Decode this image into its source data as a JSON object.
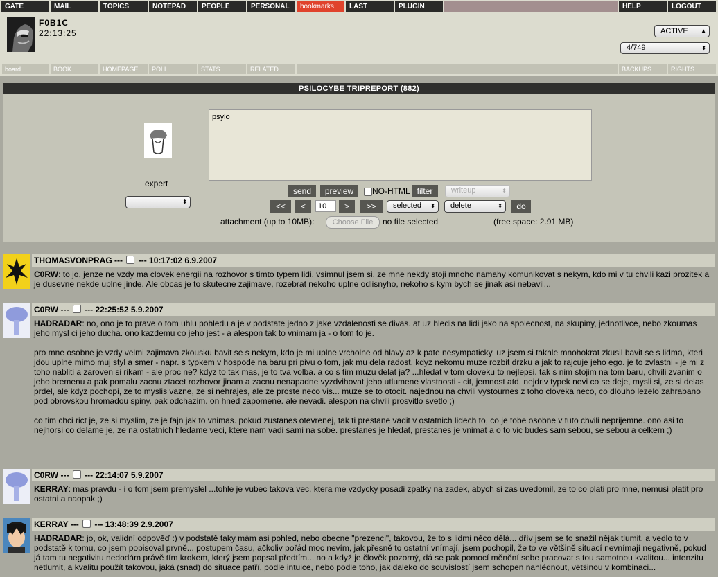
{
  "nav": {
    "items": [
      "GATE",
      "MAIL",
      "TOPICS",
      "NOTEPAD",
      "PEOPLE",
      "PERSONAL",
      "bookmarks",
      "LAST",
      "PLUGIN"
    ],
    "help": "HELP",
    "logout": "LOGOUT"
  },
  "user": {
    "name": "F0B1C",
    "time": "22:13:25"
  },
  "status_select": "ACTIVE",
  "counter_select": "4/749",
  "subnav": {
    "items": [
      "board",
      "BOOK",
      "HOMEPAGE",
      "POLL",
      "STATS",
      "RELATED"
    ],
    "right": [
      "BACKUPS",
      "RIGHTS"
    ]
  },
  "board": {
    "title": "PSILOCYBE TRIPREPORT (882)"
  },
  "compose": {
    "expert_label": "expert",
    "text": "psylo",
    "send": "send",
    "preview": "preview",
    "nohtml": "NO-HTML",
    "filter": "filter",
    "writeup": "writeup",
    "first": "<<",
    "prev": "<",
    "page": "10",
    "next": ">",
    "last": ">>",
    "selected": "selected",
    "delete": "delete",
    "do": "do",
    "attachment": "attachment (up to 10MB):",
    "choose_file": "Choose File",
    "no_file": "no file selected",
    "free_space": "(free space: 2.91 MB)"
  },
  "posts": [
    {
      "author": "THOMASVONPRAG",
      "sep": "---",
      "datetime": "--- 10:17:02 6.9.2007",
      "to": "C0RW",
      "text": ": to jo, jenze ne vzdy ma clovek energii na rozhovor s timto typem lidi, vsimnul jsem si, ze mne nekdy stoji mnoho namahy komunikovat s nekym, kdo mi v tu chvili kazi prozitek a je dusevne nekde uplne jinde. Ale obcas je to skutecne zajimave, rozebrat nekoho uplne odlisnyho, nekoho s kym bych se jinak asi nebavil..."
    },
    {
      "author": "C0RW",
      "sep": "---",
      "datetime": "--- 22:25:52 5.9.2007",
      "to": "HADRADAR",
      "text": ": no, ono je to prave o tom uhlu pohledu a je v podstate jedno z jake vzdalenosti se divas. at uz hledis na lidi jako na spolecnost, na skupiny, jednotlivce, nebo zkoumas jeho mysl ci jeho ducha. ono kazdemu co jeho jest - a alespon tak to vnimam ja - o tom to je.",
      "p2": "pro mne osobne je vzdy velmi zajimava zkousku bavit se s nekym, kdo je mi uplne vrcholne od hlavy az k pate nesympaticky. uz jsem si takhle mnohokrat zkusil bavit se s lidma, kteri jdou uplne mimo muj styl a smer - napr. s typkem v hospode na baru pri pivu o tom, jak mu dela radost, kdyz nekomu muze rozbit drzku a jak to rajcuje jeho ego. je to zvlastni - je mi z toho nabliti a zaroven si rikam - ale proc ne? kdyz to tak mas, je to tva volba. a co s tim muzu delat ja? ...hledat v tom cloveku to nejlepsi. tak s nim stojim na tom baru, chvili zvanim o jeho bremenu a pak pomalu zacnu ztacet rozhovor jinam a zacnu nenapadne vyzdvihovat jeho utlumene vlastnosti - cit, jemnost atd. nejdriv typek nevi co se deje, mysli si, ze si delas prdel, ale kdyz pochopi, ze to myslis vazne, ze si nehrajes, ale ze proste neco vis... muze se to otocit. najednou na chvili vystournes z toho cloveka neco, co dlouho lezelo zahrabano pod obrovskou hromadou spiny. pak odchazim. on hned zapomene. ale nevadi. alespon na chvili prosvitlo svetlo ;)",
      "p3": "co tim chci rict je, ze si myslim, ze je fajn jak to vnimas. pokud zustanes otevrenej, tak ti prestane vadit v ostatnich lidech to, co je tobe osobne v tuto chvili neprijemne. ono asi to nejhorsi co delame je, ze na ostatnich hledame veci, ktere nam vadi sami na sobe. prestanes je hledat, prestanes je vnimat a o to vic budes sam sebou, se sebou a celkem ;)"
    },
    {
      "author": "C0RW",
      "sep": "---",
      "datetime": "--- 22:14:07 5.9.2007",
      "to": "KERRAY",
      "text": ": mas pravdu - i o tom jsem premyslel ...tohle je vubec takova vec, ktera me vzdycky posadi zpatky na zadek, abych si zas uvedomil, ze to co plati pro mne, nemusi platit pro ostatni a naopak ;)"
    },
    {
      "author": "KERRAY",
      "sep": "---",
      "datetime": "--- 13:48:39 2.9.2007",
      "to": "HADRADAR",
      "text": ": jo, ok, validní odpověď :) v podstatě taky mám asi pohled, nebo obecne \"prezenci\", takovou, že to s lidmi něco dělá... dřív jsem se to snažil nějak tlumit, a vedlo to v podstatě k tomu, co jsem popisoval prvně... postupem času, ačkoliv pořád moc nevím, jak přesně to ostatní vnímají, jsem pochopil, že to ve většině situací nevnímají negativně, pokud já tam tu negativitu nedodám právě tím krokem, který jsem popsal předtím... no a když je člověk pozorný, dá se pak pomocí měnění sebe pracovat s tou samotnou kvalitou... intenzitu netlumit, a kvalitu použít takovou, jaká (snad) do situace patří, podle intuice, nebo podle toho, jak daleko do souvislostí jsem schopen nahlédnout, většinou v kombinaci..."
    }
  ]
}
